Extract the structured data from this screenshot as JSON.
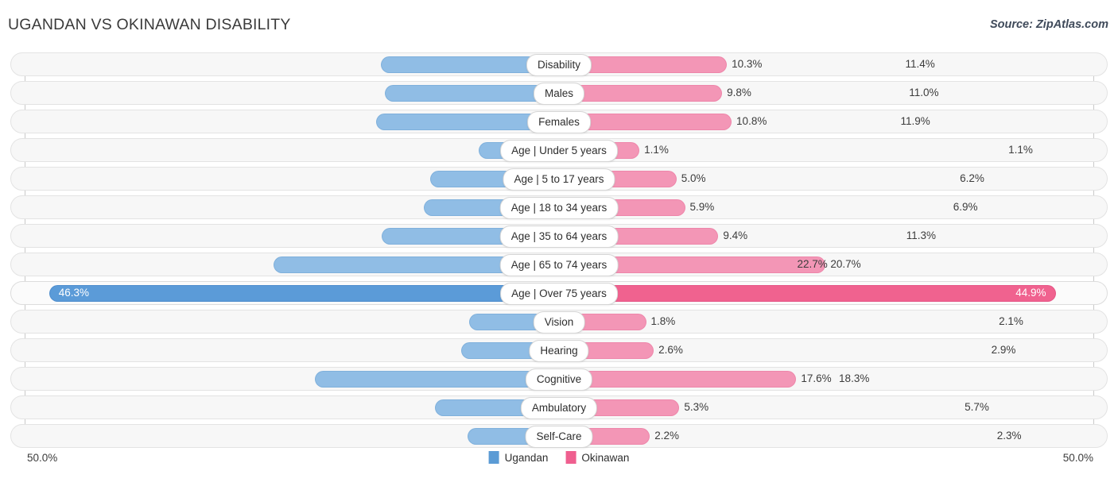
{
  "header": {
    "title": "UGANDAN VS OKINAWAN DISABILITY",
    "source": "Source: ZipAtlas.com"
  },
  "axis": {
    "left_label": "50.0%",
    "right_label": "50.0%",
    "max": 50.0
  },
  "legend": {
    "items": [
      {
        "label": "Ugandan",
        "color": "#5b9bd5"
      },
      {
        "label": "Okinawan",
        "color": "#ef5f8f"
      }
    ]
  },
  "colors": {
    "left_bar": "#90bde5",
    "right_bar": "#f396b6",
    "left_bar_highlight": "#5b9bd8",
    "right_bar_highlight": "#f0628f",
    "track": "#f7f7f7"
  },
  "chart_data": {
    "type": "bar",
    "title": "UGANDAN VS OKINAWAN DISABILITY",
    "orientation": "horizontal-diverging",
    "xlabel": "",
    "ylabel": "",
    "xlim": [
      -50.0,
      50.0
    ],
    "axis_tick_labels": [
      "50.0%",
      "50.0%"
    ],
    "grid": false,
    "legend_position": "bottom-center",
    "categories": [
      "Disability",
      "Males",
      "Females",
      "Age | Under 5 years",
      "Age | 5 to 17 years",
      "Age | 18 to 34 years",
      "Age | 35 to 64 years",
      "Age | 65 to 74 years",
      "Age | Over 75 years",
      "Vision",
      "Hearing",
      "Cognitive",
      "Ambulatory",
      "Self-Care"
    ],
    "series": [
      {
        "name": "Ugandan",
        "color": "#5b9bd5",
        "values": [
          11.4,
          11.0,
          11.9,
          1.1,
          6.2,
          6.9,
          11.3,
          22.7,
          46.3,
          2.1,
          2.9,
          18.3,
          5.7,
          2.3
        ],
        "labels": [
          "11.4%",
          "11.0%",
          "11.9%",
          "1.1%",
          "6.2%",
          "6.9%",
          "11.3%",
          "22.7%",
          "46.3%",
          "2.1%",
          "2.9%",
          "18.3%",
          "5.7%",
          "2.3%"
        ]
      },
      {
        "name": "Okinawan",
        "color": "#ef5f8f",
        "values": [
          10.3,
          9.8,
          10.8,
          1.1,
          5.0,
          5.9,
          9.4,
          20.7,
          44.9,
          1.8,
          2.6,
          17.6,
          5.3,
          2.2
        ],
        "labels": [
          "10.3%",
          "9.8%",
          "10.8%",
          "1.1%",
          "5.0%",
          "5.9%",
          "9.4%",
          "20.7%",
          "44.9%",
          "1.8%",
          "2.6%",
          "17.6%",
          "5.3%",
          "2.2%"
        ]
      }
    ],
    "highlighted_category": "Age | Over 75 years"
  }
}
